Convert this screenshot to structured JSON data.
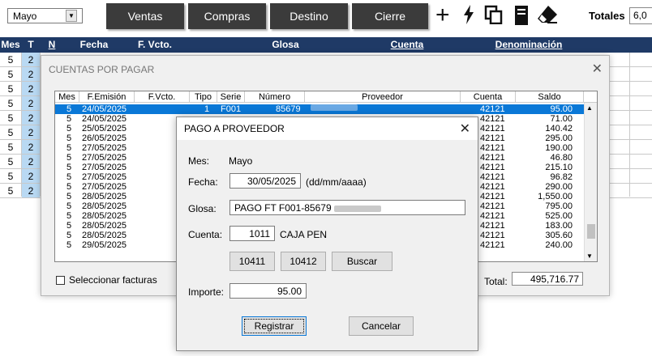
{
  "toolbar": {
    "month": "Mayo",
    "buttons": [
      "Ventas",
      "Compras",
      "Destino",
      "Cierre"
    ],
    "icons": [
      "plus-icon",
      "bolt-icon",
      "copy-icon",
      "document-icon",
      "eraser-icon"
    ],
    "totales_label": "Totales",
    "totales_value": "6,0"
  },
  "grid": {
    "headers": [
      "Mes",
      "T",
      "N",
      "Fecha",
      "F. Vcto.",
      "Glosa",
      "Cuenta",
      "Denominación"
    ],
    "rows": [
      [
        "5",
        "2"
      ],
      [
        "5",
        "2"
      ],
      [
        "5",
        "2"
      ],
      [
        "5",
        "2"
      ],
      [
        "5",
        "2"
      ],
      [
        "5",
        "2"
      ],
      [
        "5",
        "2"
      ],
      [
        "5",
        "2"
      ],
      [
        "5",
        "2"
      ],
      [
        "5",
        "2"
      ]
    ]
  },
  "cpp": {
    "title": "CUENTAS POR PAGAR",
    "headers": [
      "Mes",
      "F.Emisión",
      "F.Vcto.",
      "Tipo",
      "Serie",
      "Número",
      "Proveedor",
      "Cuenta",
      "Saldo"
    ],
    "rows": [
      {
        "mes": "5",
        "fecha": "24/05/2025",
        "tipo": "1",
        "serie": "F001",
        "numero": "85679",
        "cuenta": "42121",
        "saldo": "95.00",
        "selected": true
      },
      {
        "mes": "5",
        "fecha": "24/05/2025",
        "cuenta": "42121",
        "saldo": "71.00"
      },
      {
        "mes": "5",
        "fecha": "25/05/2025",
        "cuenta": "42121",
        "saldo": "140.42"
      },
      {
        "mes": "5",
        "fecha": "26/05/2025",
        "cuenta": "42121",
        "saldo": "295.00"
      },
      {
        "mes": "5",
        "fecha": "27/05/2025",
        "cuenta": "42121",
        "saldo": "190.00"
      },
      {
        "mes": "5",
        "fecha": "27/05/2025",
        "cuenta": "42121",
        "saldo": "46.80"
      },
      {
        "mes": "5",
        "fecha": "27/05/2025",
        "cuenta": "42121",
        "saldo": "215.10"
      },
      {
        "mes": "5",
        "fecha": "27/05/2025",
        "cuenta": "42121",
        "saldo": "96.82"
      },
      {
        "mes": "5",
        "fecha": "27/05/2025",
        "cuenta": "42121",
        "saldo": "290.00"
      },
      {
        "mes": "5",
        "fecha": "28/05/2025",
        "cuenta": "42121",
        "saldo": "1,550.00"
      },
      {
        "mes": "5",
        "fecha": "28/05/2025",
        "cuenta": "42121",
        "saldo": "795.00"
      },
      {
        "mes": "5",
        "fecha": "28/05/2025",
        "cuenta": "42121",
        "saldo": "525.00"
      },
      {
        "mes": "5",
        "fecha": "28/05/2025",
        "cuenta": "42121",
        "saldo": "183.00"
      },
      {
        "mes": "5",
        "fecha": "28/05/2025",
        "cuenta": "42121",
        "saldo": "305.60"
      },
      {
        "mes": "5",
        "fecha": "29/05/2025",
        "cuenta": "42121",
        "saldo": "240.00"
      }
    ],
    "select_label": "Seleccionar facturas",
    "total_label": "Total:",
    "total_value": "495,716.77"
  },
  "dialog": {
    "title": "PAGO A PROVEEDOR",
    "mes_label": "Mes:",
    "mes_value": "Mayo",
    "fecha_label": "Fecha:",
    "fecha_value": "30/05/2025",
    "fecha_hint": "(dd/mm/aaaa)",
    "glosa_label": "Glosa:",
    "glosa_value": "PAGO FT F001-85679",
    "cuenta_label": "Cuenta:",
    "cuenta_value": "1011",
    "cuenta_name": "CAJA PEN",
    "quick1": "10411",
    "quick2": "10412",
    "buscar": "Buscar",
    "importe_label": "Importe:",
    "importe_value": "95.00",
    "registrar": "Registrar",
    "cancelar": "Cancelar"
  }
}
